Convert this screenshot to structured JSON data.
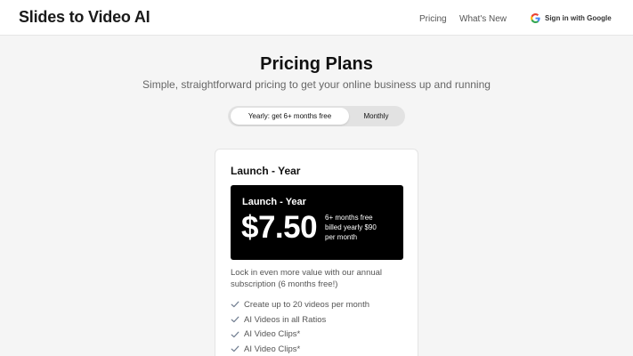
{
  "header": {
    "brand": "Slides to Video AI",
    "nav": [
      {
        "label": "Pricing"
      },
      {
        "label": "What's New"
      }
    ],
    "signin_label": "Sign in with Google",
    "signin_icon": "google-icon"
  },
  "page": {
    "title": "Pricing Plans",
    "subtitle": "Simple, straightforward pricing to get your online business up and running"
  },
  "billing_toggle": {
    "options": [
      {
        "label": "Yearly: get 6+ months free",
        "selected": true
      },
      {
        "label": "Monthly",
        "selected": false
      }
    ]
  },
  "plan": {
    "name": "Launch - Year",
    "price_box_title": "Launch - Year",
    "price": "$7.50",
    "notes": [
      "6+ months free",
      "billed yearly $90",
      "per month"
    ],
    "description": "Lock in even more value with our annual subscription (6 months free!)",
    "features": [
      {
        "label": "Create up to 20 videos per month",
        "icon": "check-icon"
      },
      {
        "label": "AI Videos in all Ratios",
        "icon": "check-icon"
      },
      {
        "label": "AI Video Clips*",
        "icon": "check-icon"
      },
      {
        "label": "AI Video Clips*",
        "icon": "check-icon"
      }
    ]
  },
  "colors": {
    "background": "#f5f5f5",
    "header_bg": "#ffffff",
    "price_box_bg": "#000000",
    "toggle_bg": "#e2e2e2",
    "check": "#6f7c8f"
  }
}
